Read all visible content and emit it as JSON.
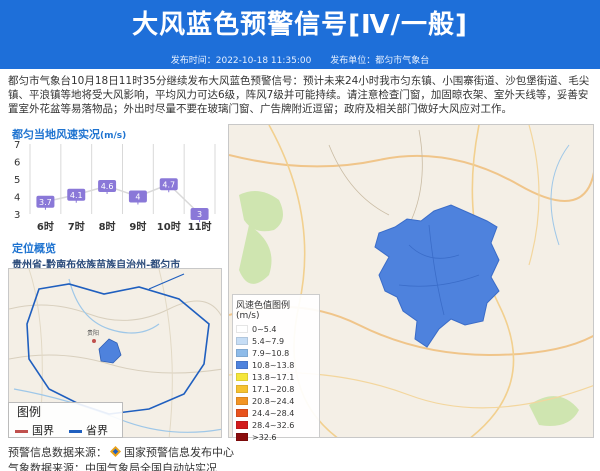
{
  "header": {
    "title": "大风蓝色预警信号[Ⅳ/一般]",
    "publish_time": "发布时间：2022-10-18 11:35:00",
    "publisher": "发布单位：都匀市气象台"
  },
  "description": "都匀市气象台10月18日11时35分继续发布大风蓝色预警信号：预计未来24小时我市匀东镇、小围寨街道、沙包堡街道、毛尖镇、平浪镇等地将受大风影响，平均风力可达6级，阵风7级并可能持续。请注意检查门窗，加固晾衣架、室外天线等，妥善安置室外花盆等易落物品；外出时尽量不要在玻璃门窗、广告牌附近逗留；政府及相关部门做好大风应对工作。",
  "wind_section": {
    "title": "都匀当地风速实况",
    "unit": "(m/s)"
  },
  "chart_data": {
    "type": "line",
    "categories": [
      "6时",
      "7时",
      "8时",
      "9时",
      "10时",
      "11时"
    ],
    "values": [
      3.7,
      4.1,
      4.6,
      4,
      4.7,
      3
    ],
    "data_labels": [
      "3.7",
      "4.1",
      "4.6",
      "4",
      "4.7",
      "3"
    ],
    "title": "都匀当地风速实况",
    "ylabel": "(m/s)",
    "ylim": [
      3,
      7
    ],
    "yticks": [
      "3",
      "4",
      "5",
      "6",
      "7"
    ]
  },
  "locate_section": {
    "title": "定位概览",
    "region": "贵州省-黔南布依族苗族自治州-都匀市"
  },
  "mini_legend": {
    "title": "图例",
    "items": [
      {
        "label": "国界",
        "color": "#c0504d"
      },
      {
        "label": "省界",
        "color": "#1f5fbf"
      }
    ]
  },
  "speed_legend": {
    "title": "风速色值图例 (m/s)",
    "items": [
      {
        "label": "0~5.4",
        "color": "#ffffff"
      },
      {
        "label": "5.4~7.9",
        "color": "#c6ddf5"
      },
      {
        "label": "7.9~10.8",
        "color": "#8ebbe9"
      },
      {
        "label": "10.8~13.8",
        "color": "#4e82dd"
      },
      {
        "label": "13.8~17.1",
        "color": "#f5e63a"
      },
      {
        "label": "17.1~20.8",
        "color": "#f6c230"
      },
      {
        "label": "20.8~24.4",
        "color": "#f29424"
      },
      {
        "label": "24.4~28.4",
        "color": "#e8521c"
      },
      {
        "label": "28.4~32.6",
        "color": "#d21a1a"
      },
      {
        "label": ">32.6",
        "color": "#8a0c0c"
      }
    ]
  },
  "footer": {
    "source_label": "预警信息数据来源：",
    "source_name": "国家预警信息发布中心",
    "line2": "气象数据来源：中国气象局全国自动站实况"
  },
  "colors": {
    "header_bg": "#1e6fd9",
    "section_title": "#1e73d0",
    "warning_area": "#4e82dd"
  }
}
